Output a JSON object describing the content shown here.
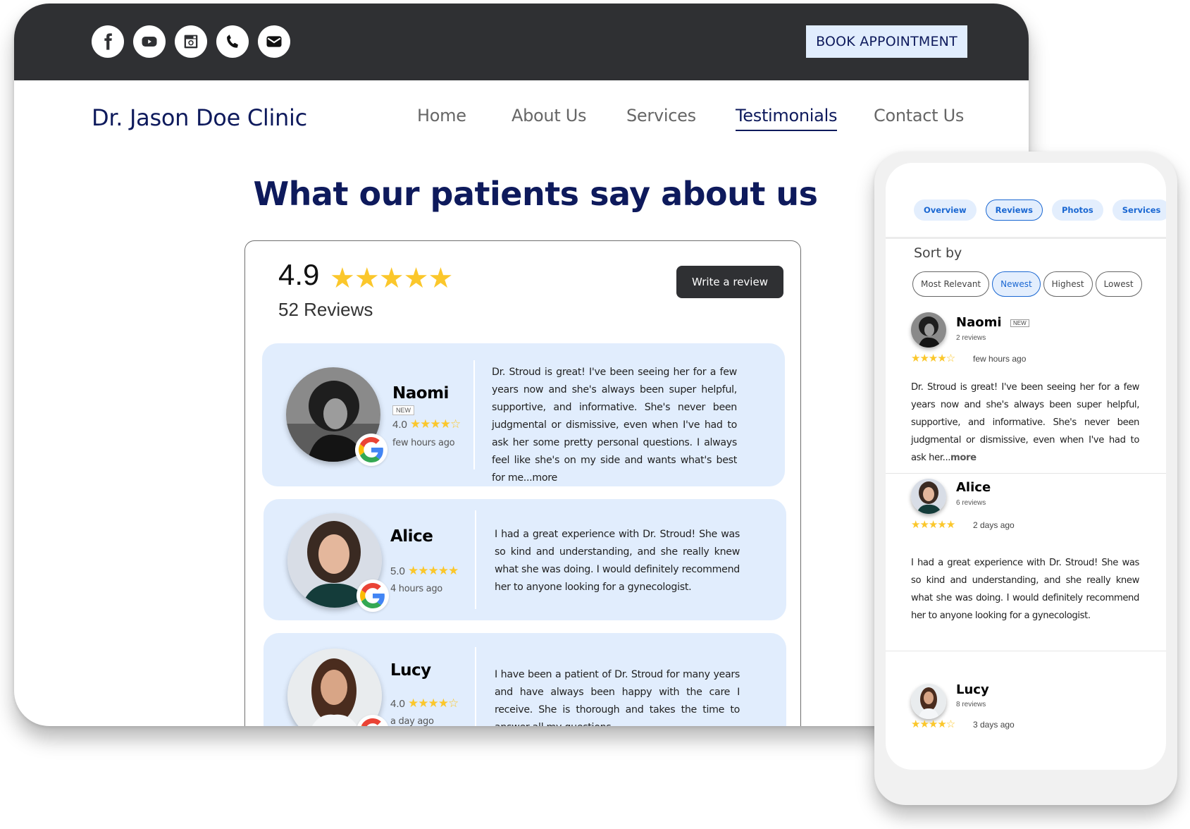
{
  "topbar": {
    "social_icons": [
      "facebook-icon",
      "youtube-icon",
      "instagram-icon",
      "phone-icon",
      "email-icon"
    ],
    "book_button": "BOOK APPOINTMENT"
  },
  "header": {
    "brand": "Dr. Jason Doe Clinic",
    "nav": [
      {
        "label": "Home",
        "active": false
      },
      {
        "label": "About Us",
        "active": false
      },
      {
        "label": "Services",
        "active": false
      },
      {
        "label": "Testimonials",
        "active": true
      },
      {
        "label": "Contact Us",
        "active": false
      }
    ]
  },
  "main": {
    "headline": "What our patients say about us",
    "summary": {
      "rating": "4.9",
      "stars": "★★★★★",
      "count": "52 Reviews",
      "write_button": "Write a review"
    },
    "reviews": [
      {
        "name": "Naomi",
        "badge": "NEW",
        "rating": "4.0",
        "stars": "★★★★☆",
        "time": "few hours ago",
        "text": "Dr. Stroud is great! I've been seeing her for a few years now and she's always been super helpful, supportive, and informative. She's never been judgmental or dismissive, even when I've had to ask her some pretty personal questions. I always feel like she's on my side and wants what's best for me...more"
      },
      {
        "name": "Alice",
        "rating": "5.0",
        "stars": "★★★★★",
        "time": "4 hours ago",
        "text": "I had a great experience with Dr. Stroud! She was so kind and understanding, and she really knew what she was doing. I would definitely recommend her to anyone looking for a gynecologist."
      },
      {
        "name": "Lucy",
        "rating": "4.0",
        "stars": "★★★★☆",
        "time": "a day ago",
        "text": "I have been a patient of Dr. Stroud for many years and have always been happy with the care I receive. She is thorough and takes the time to answer all my questions."
      }
    ]
  },
  "phone": {
    "tabs": [
      {
        "label": "Overview",
        "active": false
      },
      {
        "label": "Reviews",
        "active": true
      },
      {
        "label": "Photos",
        "active": false
      },
      {
        "label": "Services",
        "active": false
      }
    ],
    "sort_label": "Sort by",
    "sort_options": [
      {
        "label": "Most Relevant",
        "active": false
      },
      {
        "label": "Newest",
        "active": true
      },
      {
        "label": "Highest",
        "active": false
      },
      {
        "label": "Lowest",
        "active": false
      }
    ],
    "reviews": [
      {
        "name": "Naomi",
        "badge": "NEW",
        "count": "2 reviews",
        "stars": "★★★★☆",
        "time": "few hours ago",
        "text": "Dr. Stroud is great! I've been seeing her for a few years now and she's always been super helpful, supportive, and informative. She's never been judgmental or dismissive, even when I've had to ask her...",
        "more": "more"
      },
      {
        "name": "Alice",
        "count": "6 reviews",
        "stars": "★★★★★",
        "time": "2 days ago",
        "text": "I had a great experience with Dr. Stroud! She was so kind and understanding, and she really knew what she was doing. I would definitely recommend her to anyone looking for a gynecologist."
      },
      {
        "name": "Lucy",
        "count": "8 reviews",
        "stars": "★★★★☆",
        "time": "3 days ago"
      }
    ]
  },
  "colors": {
    "dark_bar": "#2f3033",
    "navy": "#0e1a5c",
    "card_blue": "#e1edfd",
    "star_gold": "#fbc72b",
    "link_blue": "#1a67d2"
  }
}
